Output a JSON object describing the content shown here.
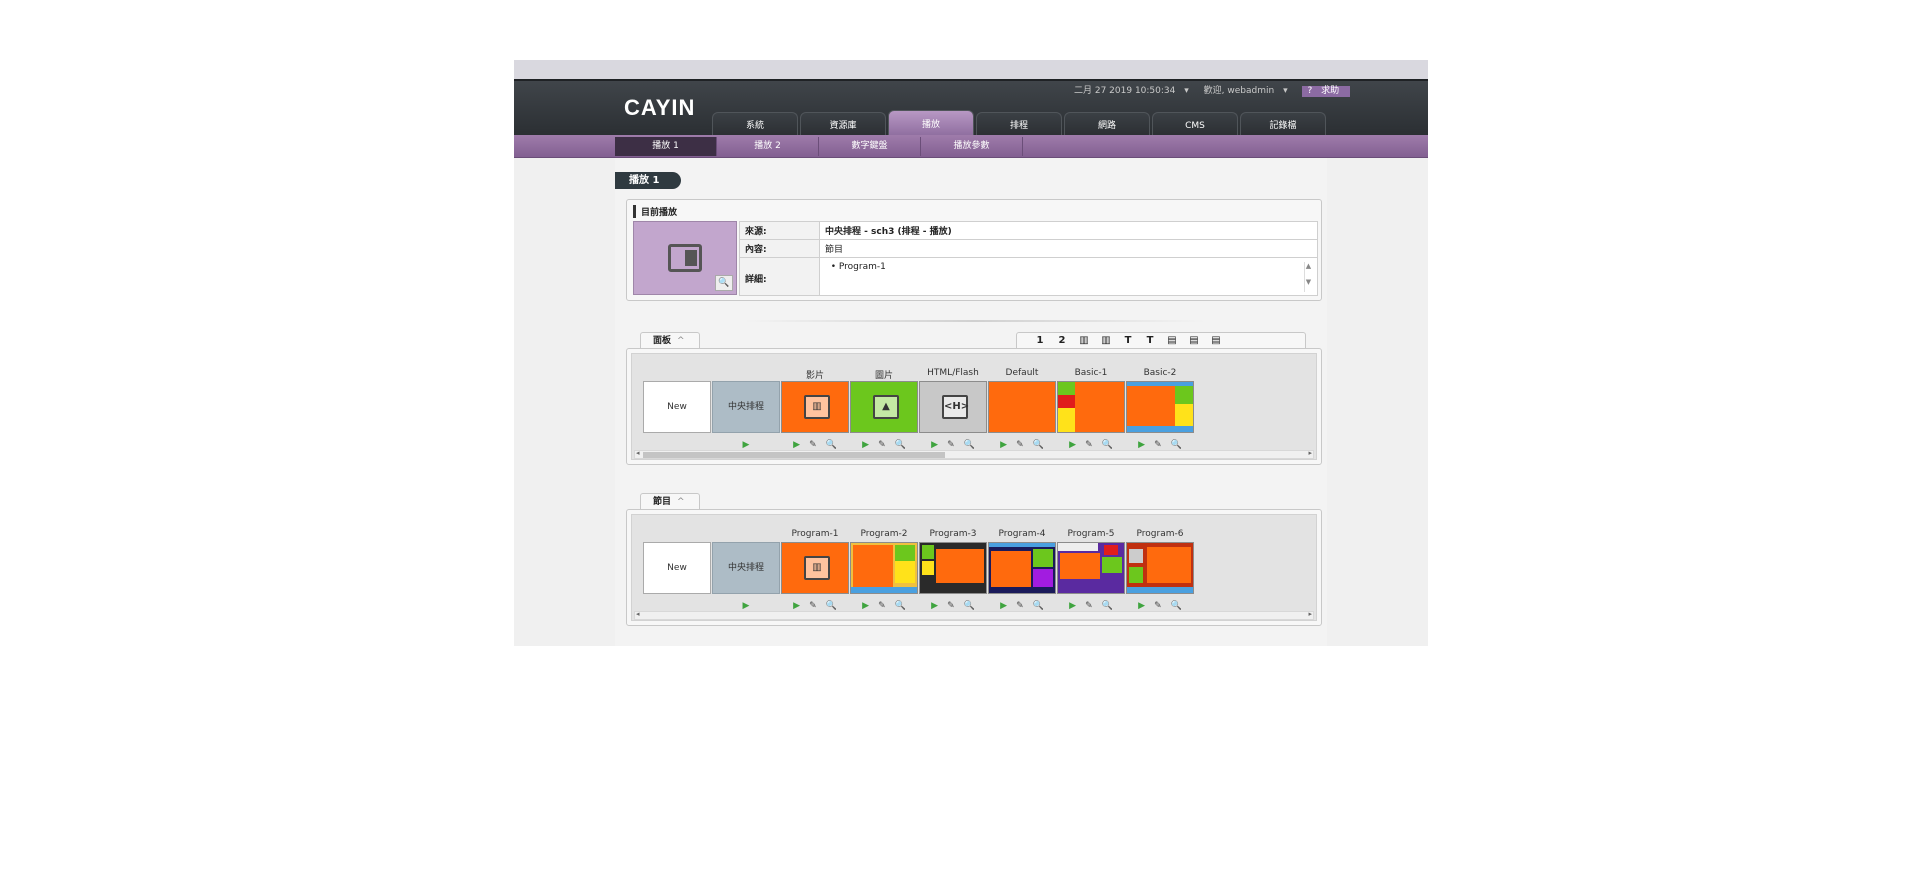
{
  "header": {
    "logo": "CAYIN",
    "datetime": "二月 27 2019 10:50:34",
    "welcome": "歡迎, webadmin",
    "help": "求助"
  },
  "tabs": [
    {
      "label": "系統"
    },
    {
      "label": "資源庫"
    },
    {
      "label": "播放",
      "active": true
    },
    {
      "label": "排程"
    },
    {
      "label": "網路"
    },
    {
      "label": "CMS"
    },
    {
      "label": "記錄檔"
    }
  ],
  "subtabs": [
    {
      "label": "播放 1",
      "active": true
    },
    {
      "label": "播放 2"
    },
    {
      "label": "數字鍵盤"
    },
    {
      "label": "播放參數"
    }
  ],
  "page": {
    "title": "播放 1"
  },
  "now_playing": {
    "title": "目前播放",
    "source_key": "來源:",
    "source_value": "中央排程 - sch3 (排程 - 播放)",
    "content_key": "內容:",
    "content_value": "節目",
    "detail_key": "詳細:",
    "detail_value": "Program-1"
  },
  "panel_section": {
    "tab_label": "面板",
    "tools": [
      "1",
      "2",
      "▥",
      "▥",
      "T",
      "T",
      "▤",
      "▤",
      "▤"
    ],
    "items": [
      {
        "label": "",
        "thumb_text": "New",
        "kind": "new"
      },
      {
        "label": "",
        "thumb_text": "中央排程",
        "kind": "central"
      },
      {
        "label": "影片",
        "thumb_text": "",
        "kind": "video",
        "color": "#ff6a0d"
      },
      {
        "label": "圖片",
        "thumb_text": "",
        "kind": "image",
        "color": "#6cc71d"
      },
      {
        "label": "HTML/Flash",
        "thumb_text": "<H>",
        "kind": "html",
        "color": "#c8c8c8"
      },
      {
        "label": "Default",
        "thumb_text": "",
        "kind": "default",
        "color": "#ff6a0d"
      },
      {
        "label": "Basic-1",
        "thumb_text": "",
        "kind": "basic1",
        "color": "#ff6a0d"
      },
      {
        "label": "Basic-2",
        "thumb_text": "",
        "kind": "basic2",
        "color": "#ff6a0d"
      }
    ]
  },
  "program_section": {
    "tab_label": "節目",
    "items": [
      {
        "label": "",
        "thumb_text": "New",
        "kind": "new"
      },
      {
        "label": "",
        "thumb_text": "中央排程",
        "kind": "central"
      },
      {
        "label": "Program-1",
        "thumb_text": "",
        "kind": "video",
        "color": "#ff6a0d"
      },
      {
        "label": "Program-2",
        "thumb_text": "",
        "kind": "p2",
        "color": "#ff6a0d"
      },
      {
        "label": "Program-3",
        "thumb_text": "",
        "kind": "p3",
        "color": "#ff6a0d"
      },
      {
        "label": "Program-4",
        "thumb_text": "",
        "kind": "p4",
        "color": "#ff6a0d"
      },
      {
        "label": "Program-5",
        "thumb_text": "",
        "kind": "p5",
        "color": "#ff6a0d"
      },
      {
        "label": "Program-6",
        "thumb_text": "",
        "kind": "p6",
        "color": "#ff6a0d"
      }
    ]
  }
}
